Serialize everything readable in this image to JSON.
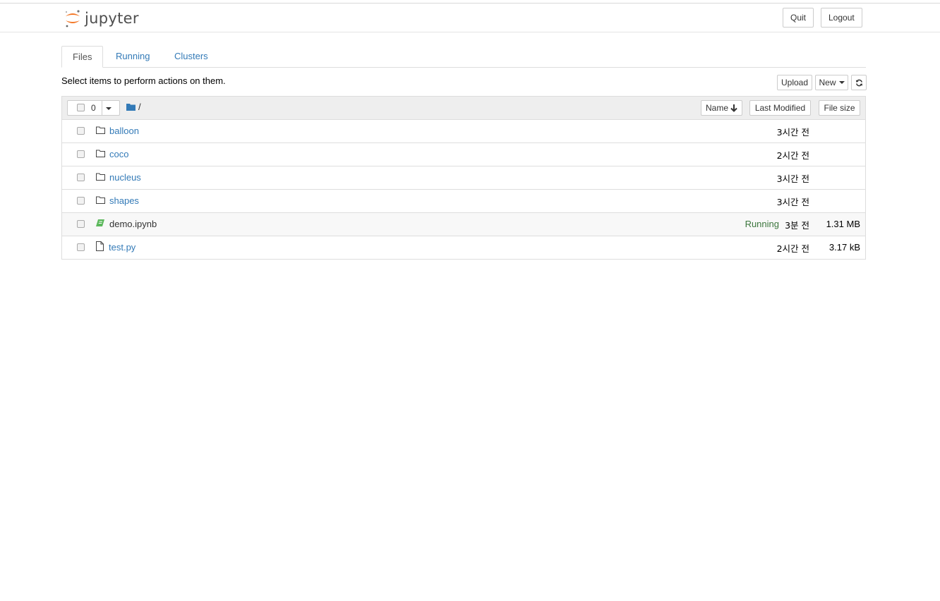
{
  "header": {
    "logo_text": "jupyter",
    "quit_label": "Quit",
    "logout_label": "Logout",
    "brand_color": "#f37726"
  },
  "tabs": [
    {
      "label": "Files",
      "active": true
    },
    {
      "label": "Running",
      "active": false
    },
    {
      "label": "Clusters",
      "active": false
    }
  ],
  "toolbar": {
    "hint": "Select items to perform actions on them.",
    "upload_label": "Upload",
    "new_label": "New",
    "refresh_icon": "refresh-icon"
  },
  "list_header": {
    "selected_count": "0",
    "breadcrumb": "/",
    "sort_name_label": "Name",
    "sort_modified_label": "Last Modified",
    "sort_size_label": "File size"
  },
  "files": [
    {
      "name": "balloon",
      "type": "folder",
      "status": "",
      "modified": "3시간 전",
      "size": ""
    },
    {
      "name": "coco",
      "type": "folder",
      "status": "",
      "modified": "2시간 전",
      "size": ""
    },
    {
      "name": "nucleus",
      "type": "folder",
      "status": "",
      "modified": "3시간 전",
      "size": ""
    },
    {
      "name": "shapes",
      "type": "folder",
      "status": "",
      "modified": "3시간 전",
      "size": ""
    },
    {
      "name": "demo.ipynb",
      "type": "notebook",
      "status": "Running",
      "modified": "3분 전",
      "size": "1.31 MB"
    },
    {
      "name": "test.py",
      "type": "file",
      "status": "",
      "modified": "2시간 전",
      "size": "3.17 kB"
    }
  ],
  "colors": {
    "link": "#337ab7",
    "running": "#3c763d",
    "notebook_icon": "#5cb85c"
  }
}
